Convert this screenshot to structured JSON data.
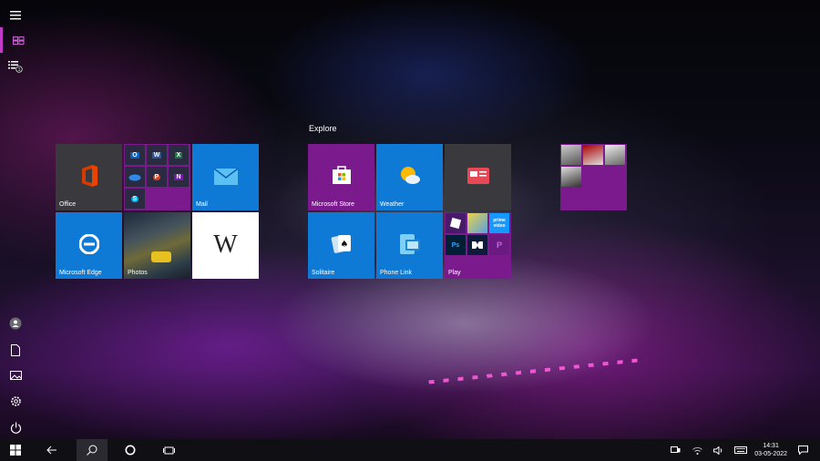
{
  "sidebar": {
    "menu_icon": "hamburger-icon",
    "items": [
      {
        "name": "all-tiles-icon"
      },
      {
        "name": "all-apps-icon",
        "badge": "1"
      }
    ],
    "bottom": [
      "user-icon",
      "documents-icon",
      "pictures-icon",
      "settings-icon",
      "power-icon"
    ]
  },
  "groups": {
    "explore_title": "Explore"
  },
  "tiles": {
    "office": "Office",
    "mail": "Mail",
    "edge": "Microsoft Edge",
    "photos": "Photos",
    "wikipedia": "W",
    "store": "Microsoft Store",
    "weather": "Weather",
    "solitaire": "Solitaire",
    "phonelink": "Phone Link",
    "play": "Play"
  },
  "office_suite": [
    "W",
    "X",
    "P",
    "N",
    "S"
  ],
  "taskbar": {
    "time": "14:31",
    "date": "03-05-2022"
  },
  "colors": {
    "accent": "#c03cc8",
    "tile_blue": "#0f7ad6",
    "tile_purple": "#7a1a8c",
    "tile_gray": "#3a3a3e"
  }
}
